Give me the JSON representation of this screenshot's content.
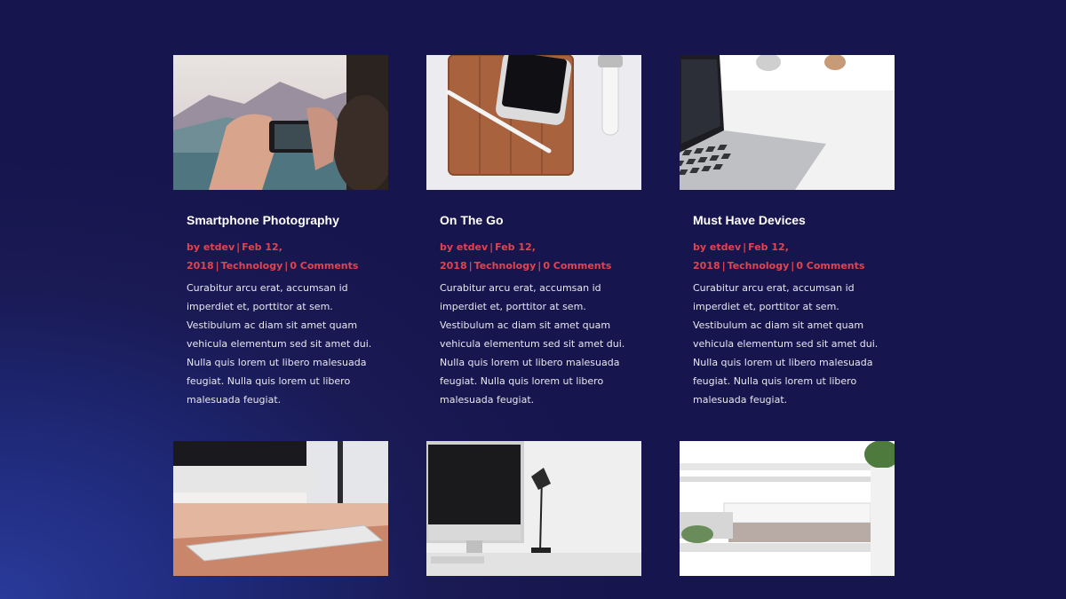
{
  "posts": [
    {
      "title": "Smartphone Photography",
      "author": "etdev",
      "date": "Feb 12, 2018",
      "category": "Technology",
      "comments": "0 Comments",
      "excerpt": "Curabitur arcu erat, accumsan id imperdiet et, porttitor at sem. Vestibulum ac diam sit amet quam vehicula elementum sed sit amet dui. Nulla quis lorem ut libero malesuada feugiat. Nulla quis lorem ut libero malesuada feugiat."
    },
    {
      "title": "On The Go",
      "author": "etdev",
      "date": "Feb 12, 2018",
      "category": "Technology",
      "comments": "0 Comments",
      "excerpt": "Curabitur arcu erat, accumsan id imperdiet et, porttitor at sem. Vestibulum ac diam sit amet quam vehicula elementum sed sit amet dui. Nulla quis lorem ut libero malesuada feugiat. Nulla quis lorem ut libero malesuada feugiat."
    },
    {
      "title": "Must Have Devices",
      "author": "etdev",
      "date": "Feb 12, 2018",
      "category": "Technology",
      "comments": "0 Comments",
      "excerpt": "Curabitur arcu erat, accumsan id imperdiet et, porttitor at sem. Vestibulum ac diam sit amet quam vehicula elementum sed sit amet dui. Nulla quis lorem ut libero malesuada feugiat. Nulla quis lorem ut libero malesuada feugiat."
    }
  ],
  "meta_by": "by",
  "colors": {
    "background": "#17154d",
    "accent": "#e3434e",
    "title": "#ffffff",
    "text": "#e8e8f0"
  }
}
